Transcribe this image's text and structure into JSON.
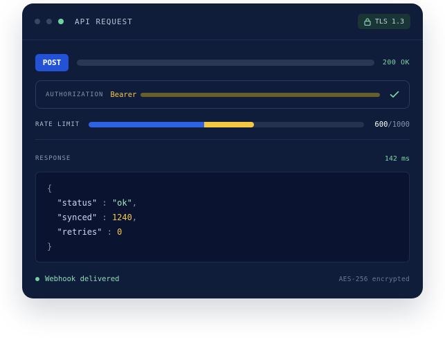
{
  "window": {
    "title": "API REQUEST",
    "tls_badge": {
      "label": "TLS 1.3",
      "icon": "lock-icon",
      "color": "#193535"
    }
  },
  "request": {
    "method": "POST",
    "status": "200 OK",
    "colors": {
      "method": "#2452d6",
      "status": "#7fd4a6"
    }
  },
  "authorization": {
    "label": "AUTHORIZATION",
    "value": "Bearer",
    "verified_icon": "check-icon"
  },
  "rate_limit": {
    "label": "RATE LIMIT",
    "used": "600",
    "total": "/1000",
    "segments": [
      {
        "name": "blue",
        "fraction": 0.42,
        "color": "#2d62e4"
      },
      {
        "name": "yellow",
        "fraction": 0.18,
        "color": "#f5c842"
      }
    ]
  },
  "response": {
    "label": "RESPONSE",
    "time": "142 ms",
    "body": {
      "open": "{",
      "close": "}",
      "fields": [
        {
          "key": "\"status\"",
          "sep": " : ",
          "value": "\"ok\"",
          "trail": ",",
          "type": "str"
        },
        {
          "key": "\"synced\"",
          "sep": " : ",
          "value": "1240",
          "trail": ",",
          "type": "num"
        },
        {
          "key": "\"retries\"",
          "sep": " : ",
          "value": "0",
          "trail": "",
          "type": "num"
        }
      ]
    }
  },
  "footer": {
    "status": "Webhook delivered",
    "encryption": "AES-256 encrypted"
  }
}
